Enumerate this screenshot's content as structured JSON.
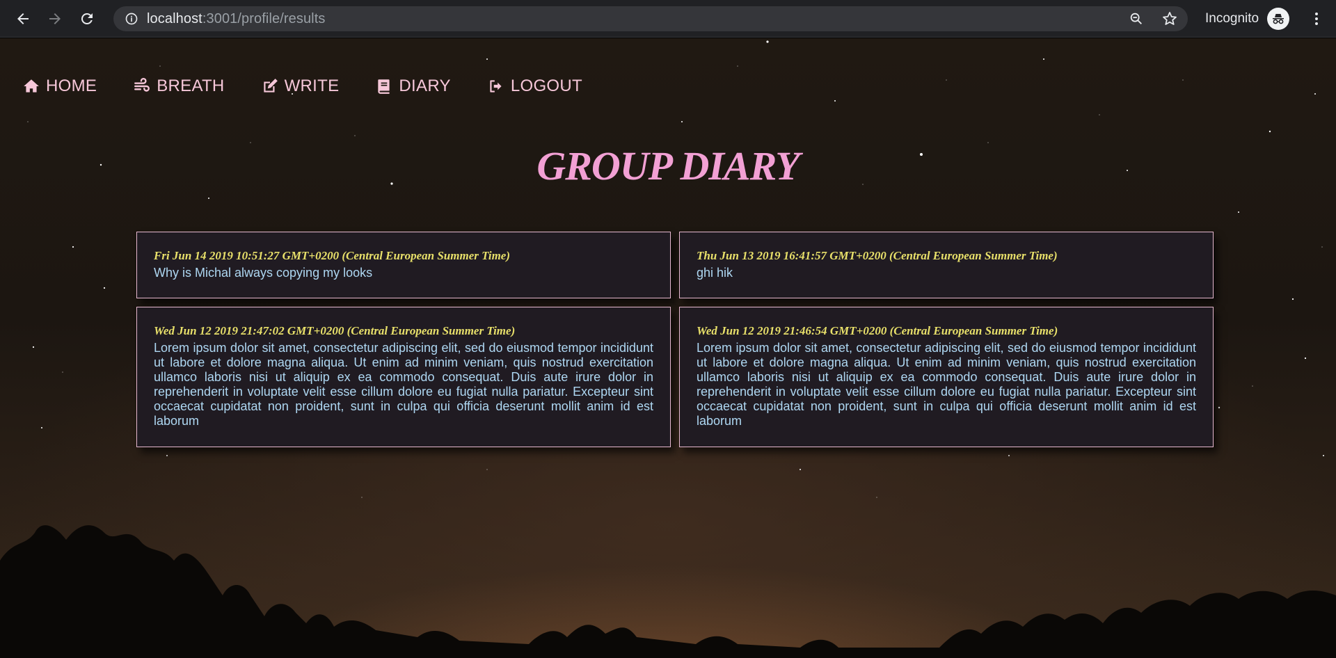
{
  "browser": {
    "url_host": "localhost",
    "url_path": ":3001/profile/results",
    "incognito_label": "Incognito",
    "icons": [
      "back-icon",
      "forward-icon",
      "reload-icon",
      "info-icon",
      "zoom-icon",
      "star-icon",
      "incognito-icon",
      "more-menu-icon"
    ]
  },
  "nav": {
    "items": [
      {
        "label": "HOME",
        "icon": "home-icon"
      },
      {
        "label": "BREATH",
        "icon": "wind-icon"
      },
      {
        "label": "WRITE",
        "icon": "edit-icon"
      },
      {
        "label": "DIARY",
        "icon": "book-icon"
      },
      {
        "label": "LOGOUT",
        "icon": "sign-out-icon"
      }
    ]
  },
  "page": {
    "title": "GROUP DIARY"
  },
  "entries": [
    {
      "date": "Fri Jun 14 2019 10:51:27 GMT+0200 (Central European Summer Time)",
      "text": "Why is Michal always copying my looks"
    },
    {
      "date": "Thu Jun 13 2019 16:41:57 GMT+0200 (Central European Summer Time)",
      "text": "ghi hik"
    },
    {
      "date": "Wed Jun 12 2019 21:47:02 GMT+0200 (Central European Summer Time)",
      "text": "Lorem ipsum dolor sit amet, consectetur adipiscing elit, sed do eiusmod tempor incididunt ut labore et dolore magna aliqua. Ut enim ad minim veniam, quis nostrud exercitation ullamco laboris nisi ut aliquip ex ea commodo consequat. Duis aute irure dolor in reprehenderit in voluptate velit esse cillum dolore eu fugiat nulla pariatur. Excepteur sint occaecat cupidatat non proident, sunt in culpa qui officia deserunt mollit anim id est laborum"
    },
    {
      "date": "Wed Jun 12 2019 21:46:54 GMT+0200 (Central European Summer Time)",
      "text": "Lorem ipsum dolor sit amet, consectetur adipiscing elit, sed do eiusmod tempor incididunt ut labore et dolore magna aliqua. Ut enim ad minim veniam, quis nostrud exercitation ullamco laboris nisi ut aliquip ex ea commodo consequat. Duis aute irure dolor in reprehenderit in voluptate velit esse cillum dolore eu fugiat nulla pariatur. Excepteur sint occaecat cupidatat non proident, sunt in culpa qui officia deserunt mollit anim id est laborum"
    }
  ],
  "colors": {
    "nav_text": "#f6c7d9",
    "title": "#f2a0d4",
    "date_text": "#e8e06a",
    "entry_text": "#aed7f2",
    "card_bg": "#201b22",
    "card_border": "#e7b9d0"
  }
}
